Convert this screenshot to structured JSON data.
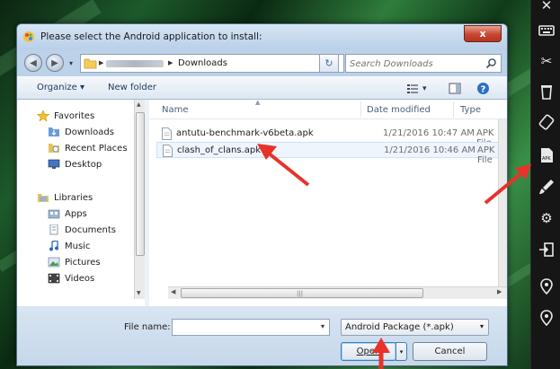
{
  "window": {
    "title": "Please select the Android application to install:",
    "close_label": "x"
  },
  "address": {
    "current_folder": "Downloads",
    "search_placeholder": "Search Downloads"
  },
  "toolbar": {
    "organize_label": "Organize",
    "new_folder_label": "New folder"
  },
  "nav": {
    "favorites_label": "Favorites",
    "favorites": [
      "Downloads",
      "Recent Places",
      "Desktop"
    ],
    "libraries_label": "Libraries",
    "libraries": [
      "Apps",
      "Documents",
      "Music",
      "Pictures",
      "Videos"
    ]
  },
  "columns": {
    "name": "Name",
    "date_modified": "Date modified",
    "type": "Type"
  },
  "files": [
    {
      "name": "antutu-benchmark-v6beta.apk",
      "date": "1/21/2016 10:47 AM",
      "type": "APK File"
    },
    {
      "name": "clash_of_clans.apk",
      "date": "1/21/2016 10:46 AM",
      "type": "APK File"
    }
  ],
  "bottom": {
    "file_name_label": "File name:",
    "file_name_value": "",
    "filter_value": "Android Package (*.apk)",
    "open_label": "Open",
    "cancel_label": "Cancel"
  },
  "colors": {
    "accent_arrow": "#e8322a",
    "dialog_frame": "#bcd2e8",
    "sidebar_bg": "#161616"
  },
  "icons": {
    "sidebar": [
      "close-icon",
      "keyboard-icon",
      "scissors-icon",
      "trash-icon",
      "rotate-icon",
      "apk-install-icon",
      "brush-icon",
      "gear-icon",
      "import-icon",
      "location-pin-icon",
      "location-pin-icon"
    ]
  }
}
